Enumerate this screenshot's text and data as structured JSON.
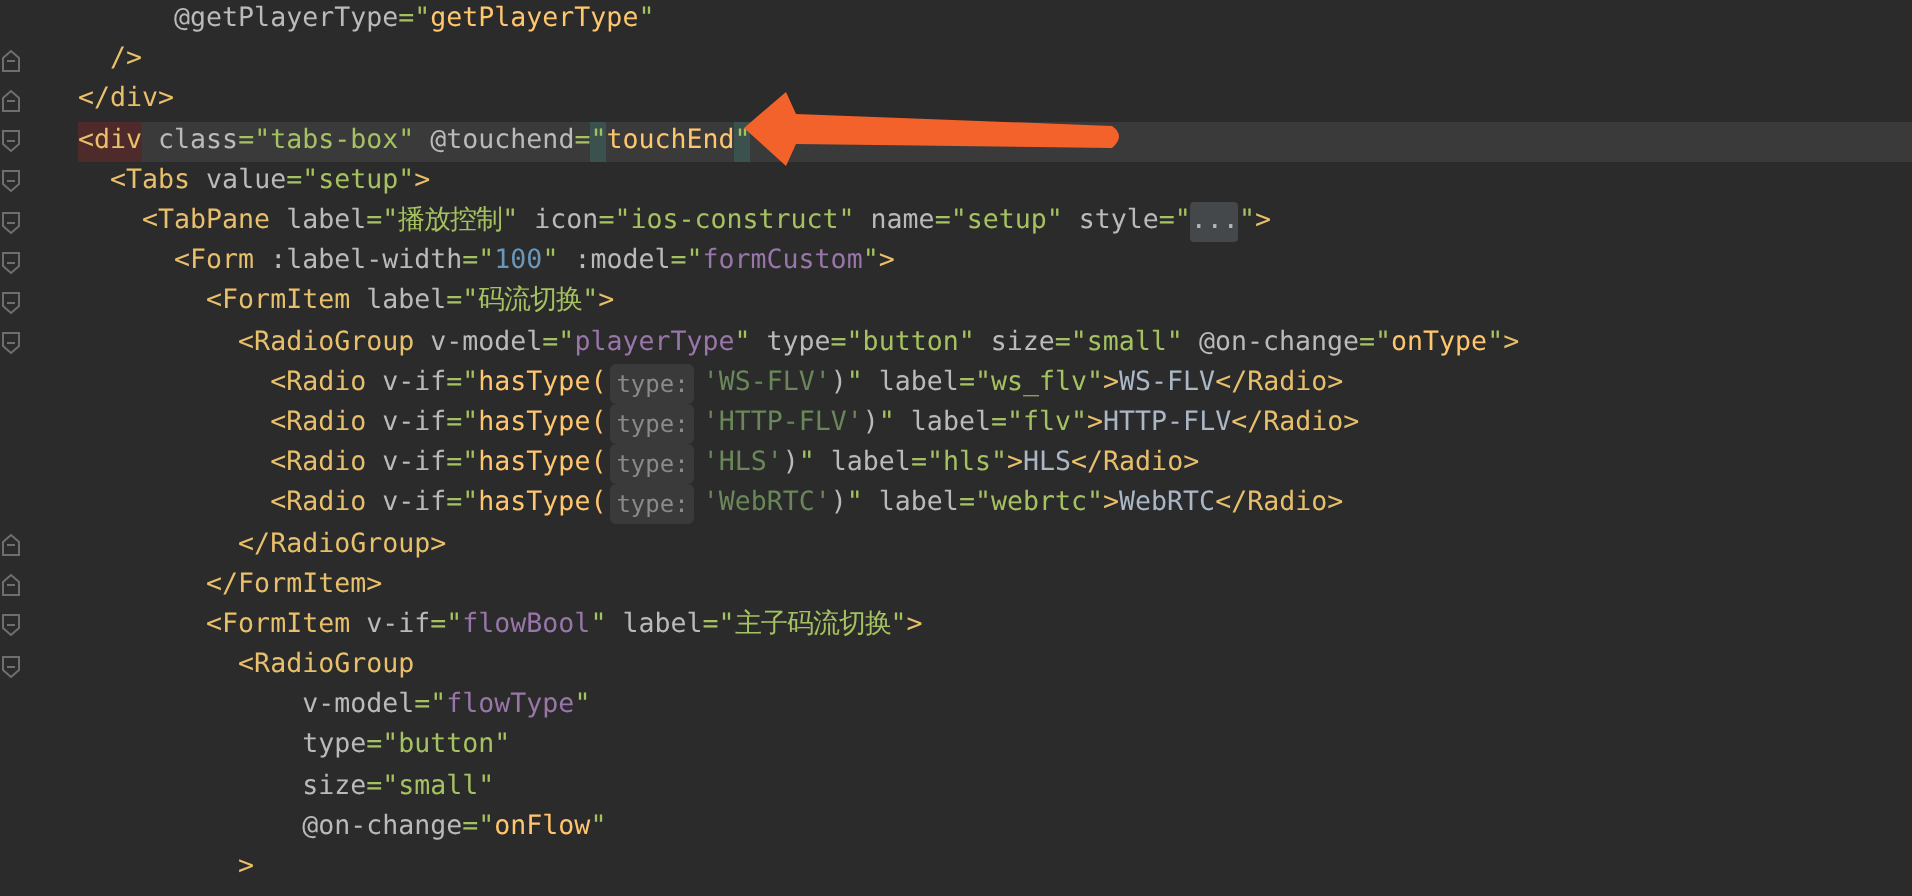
{
  "lines": [
    {
      "current": false,
      "fold_open": false,
      "fold_close": false,
      "tokens": [
        {
          "kind": "attr",
          "text": "      @getPlayerType"
        },
        {
          "kind": "str",
          "text": "=\""
        },
        {
          "kind": "expr",
          "text": "getPlayerType"
        },
        {
          "kind": "str",
          "text": "\""
        }
      ]
    },
    {
      "current": false,
      "fold_open": false,
      "fold_close": true,
      "tokens": [
        {
          "kind": "tag",
          "text": "  />"
        }
      ]
    },
    {
      "current": false,
      "fold_open": false,
      "fold_close": true,
      "tokens": [
        {
          "kind": "tag",
          "text": "</div>"
        }
      ]
    },
    {
      "current": true,
      "fold_open": true,
      "fold_close": false,
      "tokens": [
        {
          "kind": "tag",
          "text": "<div",
          "match": true
        },
        {
          "kind": "attr",
          "text": " class"
        },
        {
          "kind": "str",
          "text": "=\"tabs-box\""
        },
        {
          "kind": "attr",
          "text": " @touchend"
        },
        {
          "kind": "str",
          "text": "="
        },
        {
          "kind": "str",
          "text": "\"",
          "match": true
        },
        {
          "kind": "expr",
          "text": "touchEnd"
        },
        {
          "kind": "str",
          "text": "\"",
          "match": true
        }
      ]
    },
    {
      "current": false,
      "fold_open": true,
      "fold_close": false,
      "tokens": [
        {
          "kind": "tag",
          "text": "  <Tabs"
        },
        {
          "kind": "attr",
          "text": " value"
        },
        {
          "kind": "str",
          "text": "=\"setup\""
        },
        {
          "kind": "tag",
          "text": ">"
        }
      ]
    },
    {
      "current": false,
      "fold_open": true,
      "fold_close": false,
      "tokens": [
        {
          "kind": "tag",
          "text": "    <TabPane"
        },
        {
          "kind": "attr",
          "text": " label"
        },
        {
          "kind": "str",
          "text": "=\"播放控制\""
        },
        {
          "kind": "attr",
          "text": " icon"
        },
        {
          "kind": "str",
          "text": "=\"ios-construct\""
        },
        {
          "kind": "attr",
          "text": " name"
        },
        {
          "kind": "str",
          "text": "=\"setup\""
        },
        {
          "kind": "attr",
          "text": " style"
        },
        {
          "kind": "str",
          "text": "=\""
        },
        {
          "kind": "collapsed",
          "text": "..."
        },
        {
          "kind": "str",
          "text": "\""
        },
        {
          "kind": "tag",
          "text": ">"
        }
      ]
    },
    {
      "current": false,
      "fold_open": true,
      "fold_close": false,
      "tokens": [
        {
          "kind": "tag",
          "text": "      <Form"
        },
        {
          "kind": "attr",
          "text": " :label-width"
        },
        {
          "kind": "str",
          "text": "=\""
        },
        {
          "kind": "num",
          "text": "100"
        },
        {
          "kind": "str",
          "text": "\""
        },
        {
          "kind": "attr",
          "text": " :model"
        },
        {
          "kind": "str",
          "text": "=\""
        },
        {
          "kind": "var",
          "text": "formCustom"
        },
        {
          "kind": "str",
          "text": "\""
        },
        {
          "kind": "tag",
          "text": ">"
        }
      ]
    },
    {
      "current": false,
      "fold_open": true,
      "fold_close": false,
      "tokens": [
        {
          "kind": "tag",
          "text": "        <FormItem"
        },
        {
          "kind": "attr",
          "text": " label"
        },
        {
          "kind": "str",
          "text": "=\"码流切换\""
        },
        {
          "kind": "tag",
          "text": ">"
        }
      ]
    },
    {
      "current": false,
      "fold_open": true,
      "fold_close": false,
      "tokens": [
        {
          "kind": "tag",
          "text": "          <RadioGroup"
        },
        {
          "kind": "attr",
          "text": " v-model"
        },
        {
          "kind": "str",
          "text": "=\""
        },
        {
          "kind": "var",
          "text": "playerType"
        },
        {
          "kind": "str",
          "text": "\""
        },
        {
          "kind": "attr",
          "text": " type"
        },
        {
          "kind": "str",
          "text": "=\"button\""
        },
        {
          "kind": "attr",
          "text": " size"
        },
        {
          "kind": "str",
          "text": "=\"small\""
        },
        {
          "kind": "attr",
          "text": " @on-change"
        },
        {
          "kind": "str",
          "text": "=\""
        },
        {
          "kind": "expr",
          "text": "onType"
        },
        {
          "kind": "str",
          "text": "\""
        },
        {
          "kind": "tag",
          "text": ">"
        }
      ]
    },
    {
      "current": false,
      "fold_open": false,
      "fold_close": false,
      "tokens": [
        {
          "kind": "tag",
          "text": "            <Radio"
        },
        {
          "kind": "attr",
          "text": " v-if"
        },
        {
          "kind": "str",
          "text": "=\""
        },
        {
          "kind": "expr",
          "text": "hasType("
        },
        {
          "kind": "hint",
          "text": "type:"
        },
        {
          "kind": "jsstr",
          "text": "'WS-FLV'"
        },
        {
          "kind": "attr",
          "text": ")"
        },
        {
          "kind": "str",
          "text": "\""
        },
        {
          "kind": "attr",
          "text": " label"
        },
        {
          "kind": "str",
          "text": "=\"ws_flv\""
        },
        {
          "kind": "tag",
          "text": ">"
        },
        {
          "kind": "text",
          "text": "WS-FLV"
        },
        {
          "kind": "tag",
          "text": "</Radio>"
        }
      ]
    },
    {
      "current": false,
      "fold_open": false,
      "fold_close": false,
      "tokens": [
        {
          "kind": "tag",
          "text": "            <Radio"
        },
        {
          "kind": "attr",
          "text": " v-if"
        },
        {
          "kind": "str",
          "text": "=\""
        },
        {
          "kind": "expr",
          "text": "hasType("
        },
        {
          "kind": "hint",
          "text": "type:"
        },
        {
          "kind": "jsstr",
          "text": "'HTTP-FLV'"
        },
        {
          "kind": "attr",
          "text": ")"
        },
        {
          "kind": "str",
          "text": "\""
        },
        {
          "kind": "attr",
          "text": " label"
        },
        {
          "kind": "str",
          "text": "=\"flv\""
        },
        {
          "kind": "tag",
          "text": ">"
        },
        {
          "kind": "text",
          "text": "HTTP-FLV"
        },
        {
          "kind": "tag",
          "text": "</Radio>"
        }
      ]
    },
    {
      "current": false,
      "fold_open": false,
      "fold_close": false,
      "tokens": [
        {
          "kind": "tag",
          "text": "            <Radio"
        },
        {
          "kind": "attr",
          "text": " v-if"
        },
        {
          "kind": "str",
          "text": "=\""
        },
        {
          "kind": "expr",
          "text": "hasType("
        },
        {
          "kind": "hint",
          "text": "type:"
        },
        {
          "kind": "jsstr",
          "text": "'HLS'"
        },
        {
          "kind": "attr",
          "text": ")"
        },
        {
          "kind": "str",
          "text": "\""
        },
        {
          "kind": "attr",
          "text": " label"
        },
        {
          "kind": "str",
          "text": "=\"hls\""
        },
        {
          "kind": "tag",
          "text": ">"
        },
        {
          "kind": "text",
          "text": "HLS"
        },
        {
          "kind": "tag",
          "text": "</Radio>"
        }
      ]
    },
    {
      "current": false,
      "fold_open": false,
      "fold_close": false,
      "tokens": [
        {
          "kind": "tag",
          "text": "            <Radio"
        },
        {
          "kind": "attr",
          "text": " v-if"
        },
        {
          "kind": "str",
          "text": "=\""
        },
        {
          "kind": "expr",
          "text": "hasType("
        },
        {
          "kind": "hint",
          "text": "type:"
        },
        {
          "kind": "jsstr",
          "text": "'WebRTC'"
        },
        {
          "kind": "attr",
          "text": ")"
        },
        {
          "kind": "str",
          "text": "\""
        },
        {
          "kind": "attr",
          "text": " label"
        },
        {
          "kind": "str",
          "text": "=\"webrtc\""
        },
        {
          "kind": "tag",
          "text": ">"
        },
        {
          "kind": "text",
          "text": "WebRTC"
        },
        {
          "kind": "tag",
          "text": "</Radio>"
        }
      ]
    },
    {
      "current": false,
      "fold_open": false,
      "fold_close": true,
      "tokens": [
        {
          "kind": "tag",
          "text": "          </RadioGroup>"
        }
      ]
    },
    {
      "current": false,
      "fold_open": false,
      "fold_close": true,
      "tokens": [
        {
          "kind": "tag",
          "text": "        </FormItem>"
        }
      ]
    },
    {
      "current": false,
      "fold_open": true,
      "fold_close": false,
      "tokens": [
        {
          "kind": "tag",
          "text": "        <FormItem"
        },
        {
          "kind": "attr",
          "text": " v-if"
        },
        {
          "kind": "str",
          "text": "=\""
        },
        {
          "kind": "var",
          "text": "flowBool"
        },
        {
          "kind": "str",
          "text": "\""
        },
        {
          "kind": "attr",
          "text": " label"
        },
        {
          "kind": "str",
          "text": "=\"主子码流切换\""
        },
        {
          "kind": "tag",
          "text": ">"
        }
      ]
    },
    {
      "current": false,
      "fold_open": true,
      "fold_close": false,
      "tokens": [
        {
          "kind": "tag",
          "text": "          <RadioGroup"
        }
      ]
    },
    {
      "current": false,
      "fold_open": false,
      "fold_close": false,
      "tokens": [
        {
          "kind": "attr",
          "text": "              v-model"
        },
        {
          "kind": "str",
          "text": "=\""
        },
        {
          "kind": "var",
          "text": "flowType"
        },
        {
          "kind": "str",
          "text": "\""
        }
      ]
    },
    {
      "current": false,
      "fold_open": false,
      "fold_close": false,
      "tokens": [
        {
          "kind": "attr",
          "text": "              type"
        },
        {
          "kind": "str",
          "text": "=\"button\""
        }
      ]
    },
    {
      "current": false,
      "fold_open": false,
      "fold_close": false,
      "tokens": [
        {
          "kind": "attr",
          "text": "              size"
        },
        {
          "kind": "str",
          "text": "=\"small\""
        }
      ]
    },
    {
      "current": false,
      "fold_open": false,
      "fold_close": false,
      "tokens": [
        {
          "kind": "attr",
          "text": "              @on-change"
        },
        {
          "kind": "str",
          "text": "=\""
        },
        {
          "kind": "expr",
          "text": "onFlow"
        },
        {
          "kind": "str",
          "text": "\""
        }
      ]
    },
    {
      "current": false,
      "fold_open": false,
      "fold_close": false,
      "tokens": [
        {
          "kind": "tag",
          "text": "          >"
        }
      ]
    }
  ]
}
